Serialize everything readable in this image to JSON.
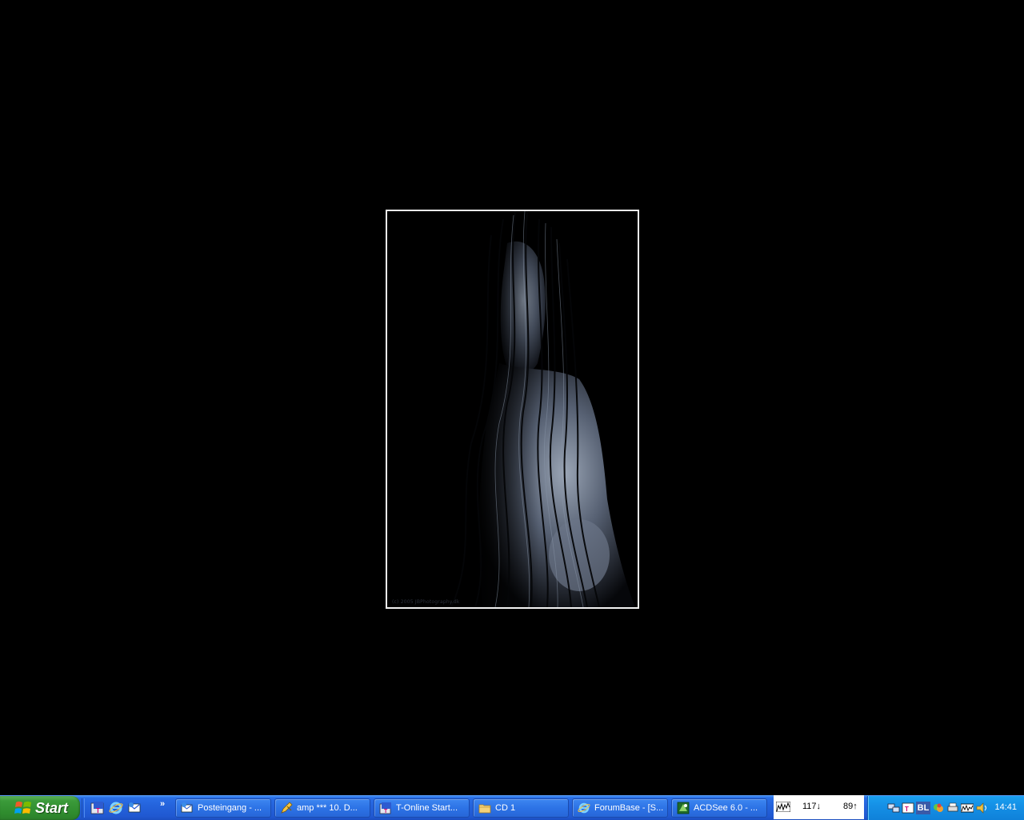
{
  "desktop": {
    "background_color": "#000000",
    "photo": {
      "caption": "(c) 2005 JBPhotography.dk"
    }
  },
  "taskbar": {
    "start_label": "Start",
    "quicklaunch_icons": [
      "t-online-icon",
      "internet-explorer-icon",
      "outlook-express-icon"
    ],
    "chevron": "»",
    "tasks": [
      {
        "label": "Posteingang - ...",
        "icon": "outlook-express-icon"
      },
      {
        "label": "amp *** 10. D...",
        "icon": "pencil-icon"
      },
      {
        "label": "T-Online Start...",
        "icon": "t-online-icon"
      },
      {
        "label": "CD 1",
        "icon": "folder-icon"
      },
      {
        "label": "ForumBase - [S...",
        "icon": "internet-explorer-icon"
      },
      {
        "label": "ACDSee 6.0 - ...",
        "icon": "acdsee-icon"
      }
    ]
  },
  "meter": {
    "download": "117↓",
    "upload": "89↑"
  },
  "tray": {
    "icons": [
      "network-icon",
      "t-online-tray-icon",
      "bl-icon",
      "messenger-icon",
      "printer-icon",
      "du-meter-icon",
      "volume-icon"
    ],
    "bl_text": "BL",
    "clock": "14:41"
  }
}
